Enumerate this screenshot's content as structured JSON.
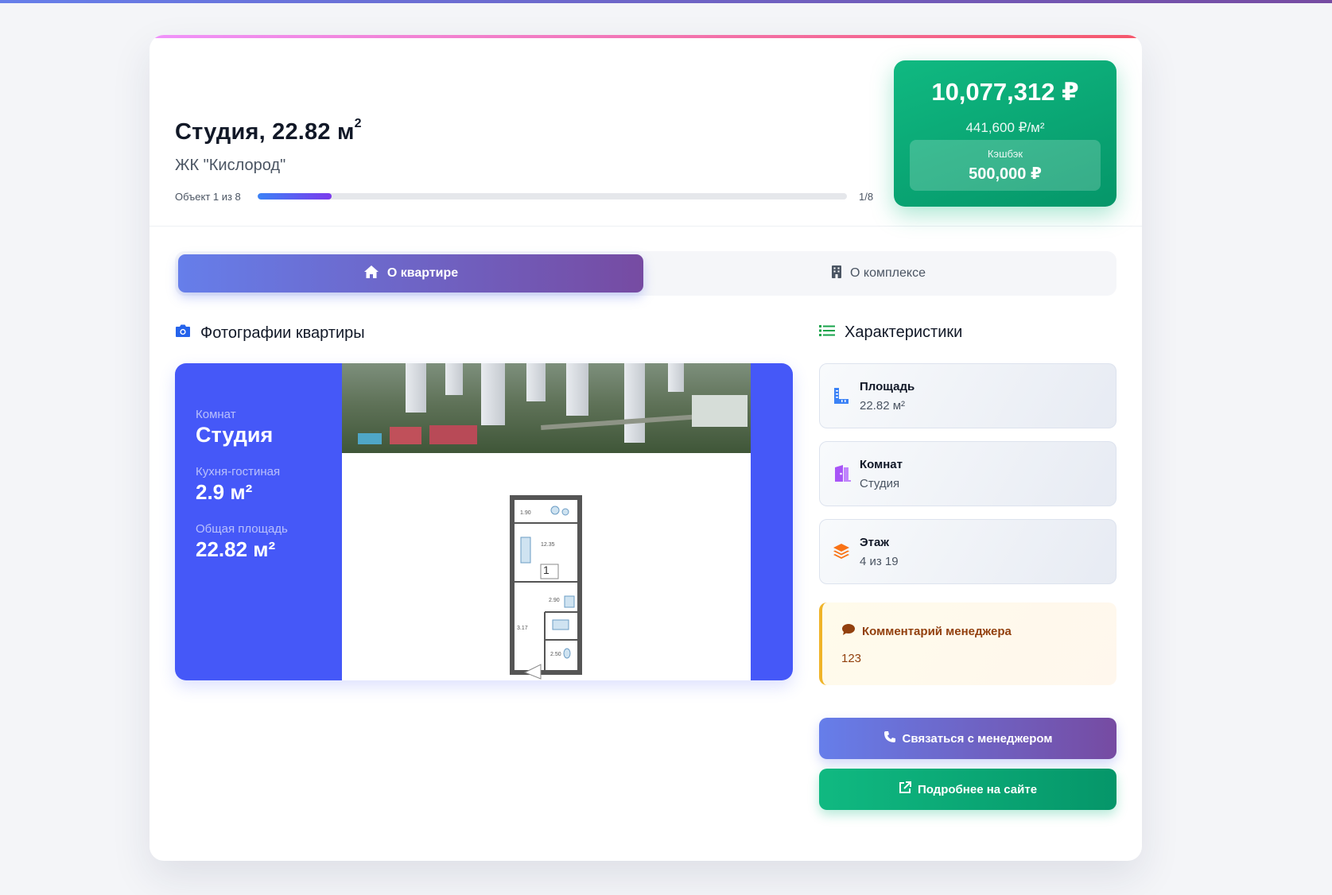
{
  "header": {
    "title": "Студия, 22.82 м",
    "title_sup": "2",
    "complex": "ЖК \"Кислород\"",
    "progress_label": "Объект 1 из 8",
    "progress_count": "1/8",
    "progress_fraction": 0.125
  },
  "price": {
    "total": "10,077,312 ₽",
    "per_sqm": "441,600 ₽/м²",
    "cashback_label": "Кэшбэк",
    "cashback_value": "500,000 ₽"
  },
  "tabs": [
    {
      "label": "О квартире",
      "icon": "home-icon",
      "active": true
    },
    {
      "label": "О комплексе",
      "icon": "building-icon",
      "active": false
    }
  ],
  "photos": {
    "title": "Фотографии квартиры",
    "info": [
      {
        "label": "Комнат",
        "value": "Студия"
      },
      {
        "label": "Кухня-гостиная",
        "value": "2.9 м²"
      },
      {
        "label": "Общая площадь",
        "value": "22.82 м²"
      }
    ],
    "plan_labels": [
      "1.90",
      "12.35",
      "1",
      "2.90",
      "3.17",
      "2.50"
    ]
  },
  "characteristics": {
    "title": "Характеристики",
    "items": [
      {
        "label": "Площадь",
        "value": "22.82 м²",
        "icon": "ruler-icon"
      },
      {
        "label": "Комнат",
        "value": "Студия",
        "icon": "door-icon"
      },
      {
        "label": "Этаж",
        "value": "4 из 19",
        "icon": "layers-icon"
      }
    ]
  },
  "comment": {
    "title": "Комментарий менеджера",
    "text": "123"
  },
  "buttons": {
    "contact": "Связаться с менеджером",
    "more": "Подробнее на сайте"
  },
  "colors": {
    "accent_gradient_start": "#667eea",
    "accent_gradient_end": "#764ba2",
    "price_green": "#10b981",
    "gallery_blue": "#4558f8",
    "comment_border": "#f0b429"
  }
}
